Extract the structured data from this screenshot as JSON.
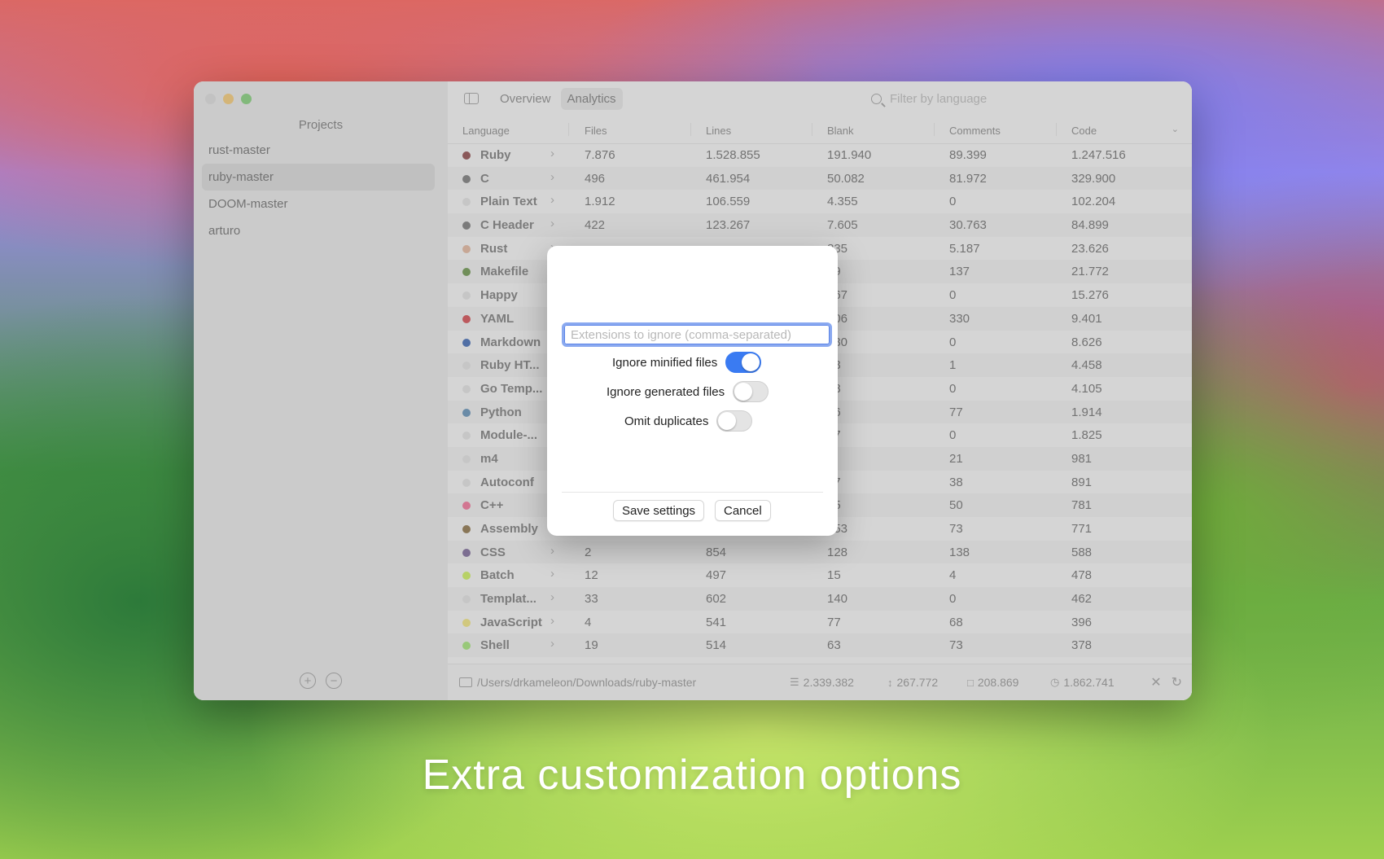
{
  "sidebar": {
    "title": "Projects",
    "projects": [
      "rust-master",
      "ruby-master",
      "DOOM-master",
      "arturo"
    ],
    "selected_index": 1,
    "add_label": "+",
    "remove_label": "−"
  },
  "toolbar": {
    "tabs": [
      {
        "label": "Overview",
        "active": false
      },
      {
        "label": "Analytics",
        "active": true
      }
    ],
    "search_placeholder": "Filter by language"
  },
  "table": {
    "headers": {
      "language": "Language",
      "files": "Files",
      "lines": "Lines",
      "blank": "Blank",
      "comments": "Comments",
      "code": "Code"
    },
    "rows": [
      {
        "language": "Ruby",
        "color": "#701516",
        "files": "7.876",
        "lines": "1.528.855",
        "blank": "191.940",
        "comments": "89.399",
        "code": "1.247.516"
      },
      {
        "language": "C",
        "color": "#555555",
        "files": "496",
        "lines": "461.954",
        "blank": "50.082",
        "comments": "81.972",
        "code": "329.900"
      },
      {
        "language": "Plain Text",
        "color": "#dddddd",
        "files": "1.912",
        "lines": "106.559",
        "blank": "4.355",
        "comments": "0",
        "code": "102.204"
      },
      {
        "language": "C Header",
        "color": "#555555",
        "files": "422",
        "lines": "123.267",
        "blank": "7.605",
        "comments": "30.763",
        "code": "84.899"
      },
      {
        "language": "Rust",
        "color": "#dea584",
        "files": "",
        "lines": "",
        "blank": "835",
        "comments": "5.187",
        "code": "23.626"
      },
      {
        "language": "Makefile",
        "color": "#427819",
        "files": "",
        "lines": "",
        "blank": "99",
        "comments": "137",
        "code": "21.772"
      },
      {
        "language": "Happy",
        "color": "#dddddd",
        "files": "",
        "lines": "",
        "blank": "667",
        "comments": "0",
        "code": "15.276"
      },
      {
        "language": "YAML",
        "color": "#cb171e",
        "files": "",
        "lines": "",
        "blank": "006",
        "comments": "330",
        "code": "9.401"
      },
      {
        "language": "Markdown",
        "color": "#083fa1",
        "files": "",
        "lines": "",
        "blank": "930",
        "comments": "0",
        "code": "8.626"
      },
      {
        "language": "Ruby HT...",
        "color": "#dddddd",
        "files": "",
        "lines": "",
        "blank": "93",
        "comments": "1",
        "code": "4.458"
      },
      {
        "language": "Go Temp...",
        "color": "#dddddd",
        "files": "",
        "lines": "",
        "blank": "08",
        "comments": "0",
        "code": "4.105"
      },
      {
        "language": "Python",
        "color": "#3572A5",
        "files": "",
        "lines": "",
        "blank": "16",
        "comments": "77",
        "code": "1.914"
      },
      {
        "language": "Module-...",
        "color": "#dddddd",
        "files": "",
        "lines": "",
        "blank": "97",
        "comments": "0",
        "code": "1.825"
      },
      {
        "language": "m4",
        "color": "#dddddd",
        "files": "",
        "lines": "",
        "blank": "",
        "comments": "21",
        "code": "981"
      },
      {
        "language": "Autoconf",
        "color": "#dddddd",
        "files": "",
        "lines": "",
        "blank": "47",
        "comments": "38",
        "code": "891"
      },
      {
        "language": "C++",
        "color": "#f34b7d",
        "files": "",
        "lines": "",
        "blank": "65",
        "comments": "50",
        "code": "781"
      },
      {
        "language": "Assembly",
        "color": "#6E4C13",
        "files": "",
        "lines": "",
        "blank": "153",
        "comments": "73",
        "code": "771"
      },
      {
        "language": "CSS",
        "color": "#563d7c",
        "files": "2",
        "lines": "854",
        "blank": "128",
        "comments": "138",
        "code": "588"
      },
      {
        "language": "Batch",
        "color": "#C1F12E",
        "files": "12",
        "lines": "497",
        "blank": "15",
        "comments": "4",
        "code": "478"
      },
      {
        "language": "Templat...",
        "color": "#dddddd",
        "files": "33",
        "lines": "602",
        "blank": "140",
        "comments": "0",
        "code": "462"
      },
      {
        "language": "JavaScript",
        "color": "#f1e05a",
        "files": "4",
        "lines": "541",
        "blank": "77",
        "comments": "68",
        "code": "396"
      },
      {
        "language": "Shell",
        "color": "#89e051",
        "files": "19",
        "lines": "514",
        "blank": "63",
        "comments": "73",
        "code": "378"
      }
    ]
  },
  "statusbar": {
    "path": "/Users/drkameleon/Downloads/ruby-master",
    "lines": "2.339.382",
    "blank": "267.772",
    "comments": "208.869",
    "code": "1.862.741"
  },
  "dialog": {
    "extensions_placeholder": "Extensions to ignore (comma-separated)",
    "extensions_value": "",
    "options": [
      {
        "label": "Ignore minified files",
        "enabled": true
      },
      {
        "label": "Ignore generated files",
        "enabled": false
      },
      {
        "label": "Omit duplicates",
        "enabled": false
      }
    ],
    "save_label": "Save settings",
    "cancel_label": "Cancel",
    "accent_color": "#3a7bf2"
  },
  "caption": "Extra customization options"
}
